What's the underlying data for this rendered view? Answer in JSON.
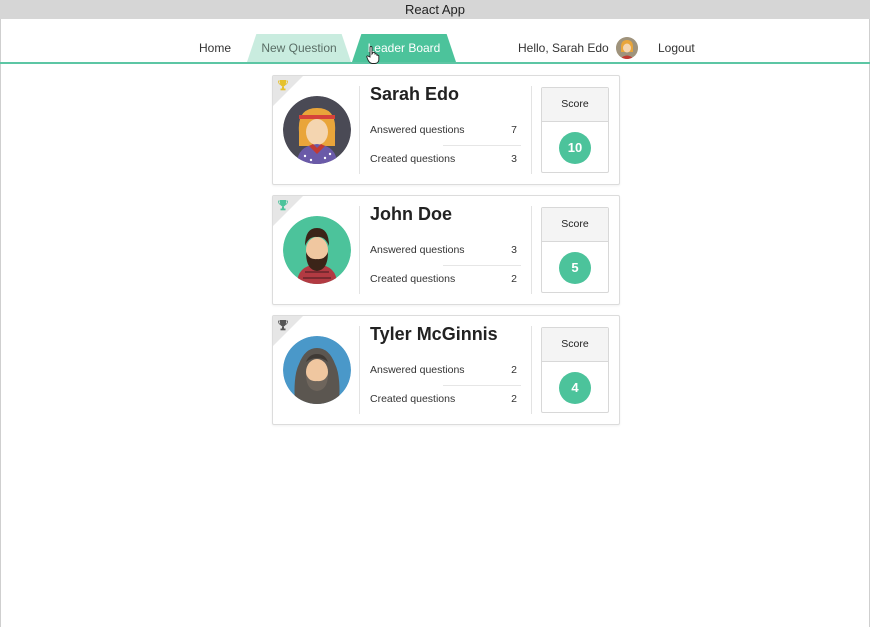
{
  "window": {
    "title": "React App"
  },
  "nav": {
    "home": "Home",
    "new_question": "New Question",
    "leader_board": "Leader Board",
    "greeting": "Hello, Sarah Edo",
    "logout": "Logout"
  },
  "colors": {
    "accent": "#4cc39b",
    "tab_inactive": "#c9ecdf",
    "trophy_gold": "#e5c12b",
    "trophy_green": "#4cc39b",
    "trophy_gray": "#555555"
  },
  "leaderboard": [
    {
      "rank_icon": "trophy-gold-icon",
      "name": "Sarah Edo",
      "answered_label": "Answered questions",
      "answered": "7",
      "created_label": "Created questions",
      "created": "3",
      "score_label": "Score",
      "score": "10",
      "avatar": "sarah-avatar"
    },
    {
      "rank_icon": "trophy-green-icon",
      "name": "John Doe",
      "answered_label": "Answered questions",
      "answered": "3",
      "created_label": "Created questions",
      "created": "2",
      "score_label": "Score",
      "score": "5",
      "avatar": "john-avatar"
    },
    {
      "rank_icon": "trophy-gray-icon",
      "name": "Tyler McGinnis",
      "answered_label": "Answered questions",
      "answered": "2",
      "created_label": "Created questions",
      "created": "2",
      "score_label": "Score",
      "score": "4",
      "avatar": "tyler-avatar"
    }
  ]
}
